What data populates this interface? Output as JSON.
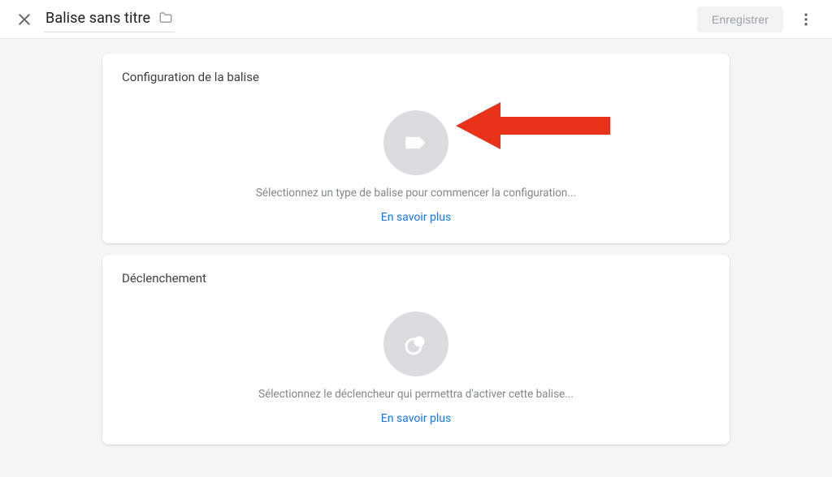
{
  "header": {
    "title": "Balise sans titre",
    "save_label": "Enregistrer"
  },
  "cards": {
    "tagConfig": {
      "title": "Configuration de la balise",
      "desc": "Sélectionnez un type de balise pour commencer la configuration...",
      "link": "En savoir plus"
    },
    "trigger": {
      "title": "Déclenchement",
      "desc": "Sélectionnez le déclencheur qui permettra d'activer cette balise...",
      "link": "En savoir plus"
    }
  }
}
